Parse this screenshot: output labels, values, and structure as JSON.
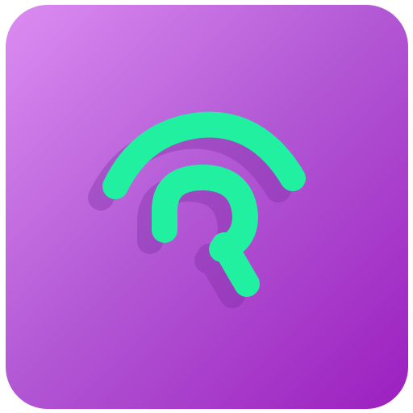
{
  "app_icon": {
    "glyph_icon": "radar-signal-r-icon",
    "colors": {
      "tile_gradient_start": "#dc8cf2",
      "tile_gradient_mid": "#b45bd6",
      "tile_gradient_end": "#9c1fbf",
      "glyph": "#22f0a1",
      "glyph_shadow": "#7a2aa0"
    }
  }
}
